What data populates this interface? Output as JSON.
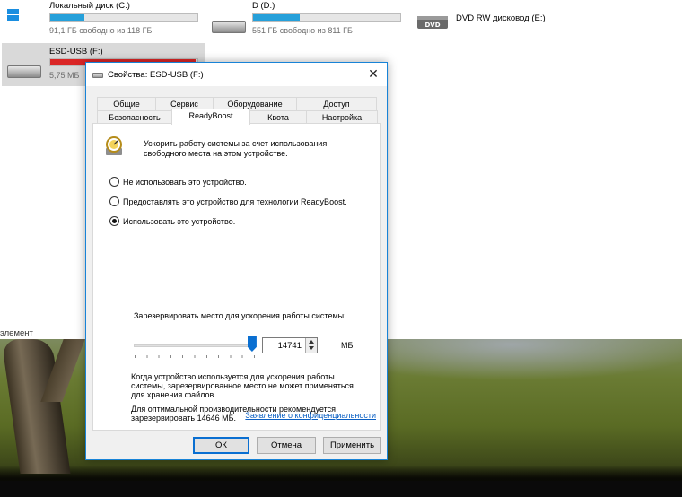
{
  "explorer": {
    "drives": [
      {
        "name": "Локальный диск (C:)",
        "free": "91,1 ГБ свободно из 118 ГБ",
        "used_fraction": 0.23
      },
      {
        "name": "D (D:)",
        "free": "551 ГБ свободно из 811 ГБ",
        "used_fraction": 0.32
      },
      {
        "name": "DVD RW дисковод (E:)"
      },
      {
        "name": "ESD-USB (F:)",
        "free": "5,75 МБ",
        "used_fraction": 0.99
      }
    ],
    "status_text": "элемент",
    "bar_color": "#26a0da",
    "bar_full_color": "#da2626"
  },
  "dialog": {
    "title": "Свойства: ESD-USB (F:)",
    "close_glyph": "✕",
    "tabs_row1": [
      "Общие",
      "Сервис",
      "Оборудование",
      "Доступ"
    ],
    "tabs_row2": [
      "Безопасность",
      "ReadyBoost",
      "Квота",
      "Настройка"
    ],
    "active_tab": "ReadyBoost",
    "intro": "Ускорить работу системы за счет использования свободного места на этом устройстве.",
    "options": [
      {
        "label": "Не использовать это устройство.",
        "selected": false
      },
      {
        "label": "Предоставлять это устройство для технологии ReadyBoost.",
        "selected": false
      },
      {
        "label": "Использовать это устройство.",
        "selected": true
      }
    ],
    "reserve_label": "Зарезервировать место для ускорения работы системы:",
    "reserve_value": "14741",
    "slider_level": 0.97,
    "unit": "МБ",
    "info1": "Когда устройство используется для ускорения работы системы, зарезервированное место не может применяться для хранения файлов.",
    "info2": "Для оптимальной производительности рекомендуется зарезервировать 14646 МБ.",
    "privacy_link": "Заявление о конфиденциальности",
    "buttons": {
      "ok": "ОК",
      "cancel": "Отмена",
      "apply": "Применить"
    },
    "icons": {
      "usb": "usb-drive-icon",
      "readyboost": "readyboost-gauge-icon"
    },
    "accent_color": "#0a6fd1"
  }
}
